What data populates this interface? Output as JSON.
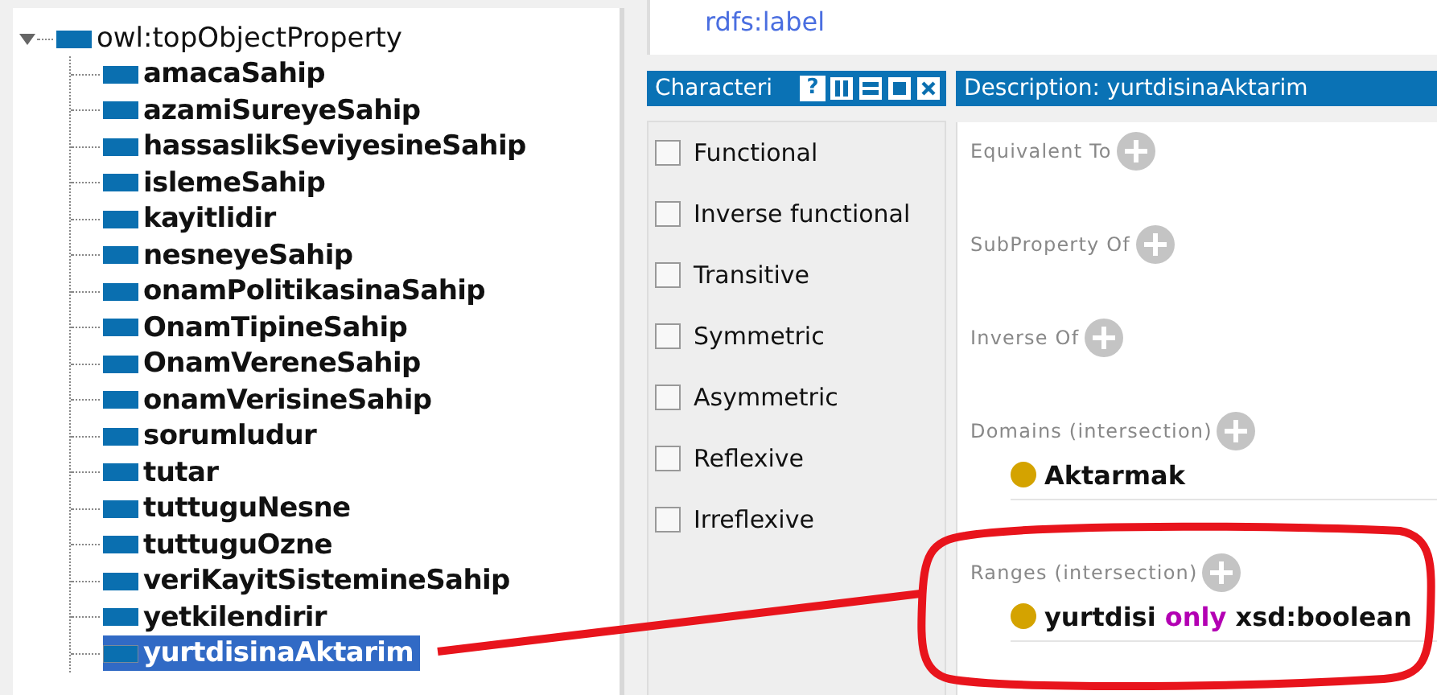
{
  "tree": {
    "label": "owl:topObjectProperty",
    "expanded": true,
    "children": [
      {
        "label": "amacaSahip",
        "selected": false
      },
      {
        "label": "azamiSureyeSahip",
        "selected": false
      },
      {
        "label": "hassaslikSeviyesineSahip",
        "selected": false
      },
      {
        "label": "islemeSahip",
        "selected": false
      },
      {
        "label": "kayitlidir",
        "selected": false
      },
      {
        "label": "nesneyeSahip",
        "selected": false
      },
      {
        "label": "onamPolitikasinaSahip",
        "selected": false
      },
      {
        "label": "OnamTipineSahip",
        "selected": false
      },
      {
        "label": "OnamVereneSahip",
        "selected": false
      },
      {
        "label": "onamVerisineSahip",
        "selected": false
      },
      {
        "label": "sorumludur",
        "selected": false
      },
      {
        "label": "tutar",
        "selected": false
      },
      {
        "label": "tuttuguNesne",
        "selected": false
      },
      {
        "label": "tuttuguOzne",
        "selected": false
      },
      {
        "label": "veriKayitSistemineSahip",
        "selected": false
      },
      {
        "label": "yetkilendirir",
        "selected": false
      },
      {
        "label": "yurtdisinaAktarim",
        "selected": true
      }
    ]
  },
  "annotations": {
    "label": "rdfs:label"
  },
  "characteristics": {
    "title": "Characteri",
    "buttons": [
      {
        "kind": "help",
        "label": "?"
      },
      {
        "kind": "columns"
      },
      {
        "kind": "rows"
      },
      {
        "kind": "maximize"
      },
      {
        "kind": "close"
      }
    ],
    "items": [
      {
        "label": "Functional",
        "checked": false
      },
      {
        "label": "Inverse functional",
        "checked": false
      },
      {
        "label": "Transitive",
        "checked": false
      },
      {
        "label": "Symmetric",
        "checked": false
      },
      {
        "label": "Asymmetric",
        "checked": false
      },
      {
        "label": "Reflexive",
        "checked": false
      },
      {
        "label": "Irreflexive",
        "checked": false
      }
    ]
  },
  "description": {
    "title": "Description: yurtdisinaAktarim",
    "sections": [
      {
        "label": "Equivalent To"
      },
      {
        "label": "SubProperty Of"
      },
      {
        "label": "Inverse Of"
      },
      {
        "label": "Domains (intersection)",
        "items": [
          {
            "color": "#d4a300",
            "tokens": [
              {
                "kind": "name",
                "text": "Aktarmak"
              }
            ]
          }
        ]
      },
      {
        "label": "Ranges (intersection)",
        "items": [
          {
            "color": "#d4a300",
            "tokens": [
              {
                "kind": "name",
                "text": "yurtdisi"
              },
              {
                "kind": "keyword",
                "text": "only"
              },
              {
                "kind": "name",
                "text": "xsd:boolean"
              }
            ]
          }
        ]
      }
    ]
  }
}
